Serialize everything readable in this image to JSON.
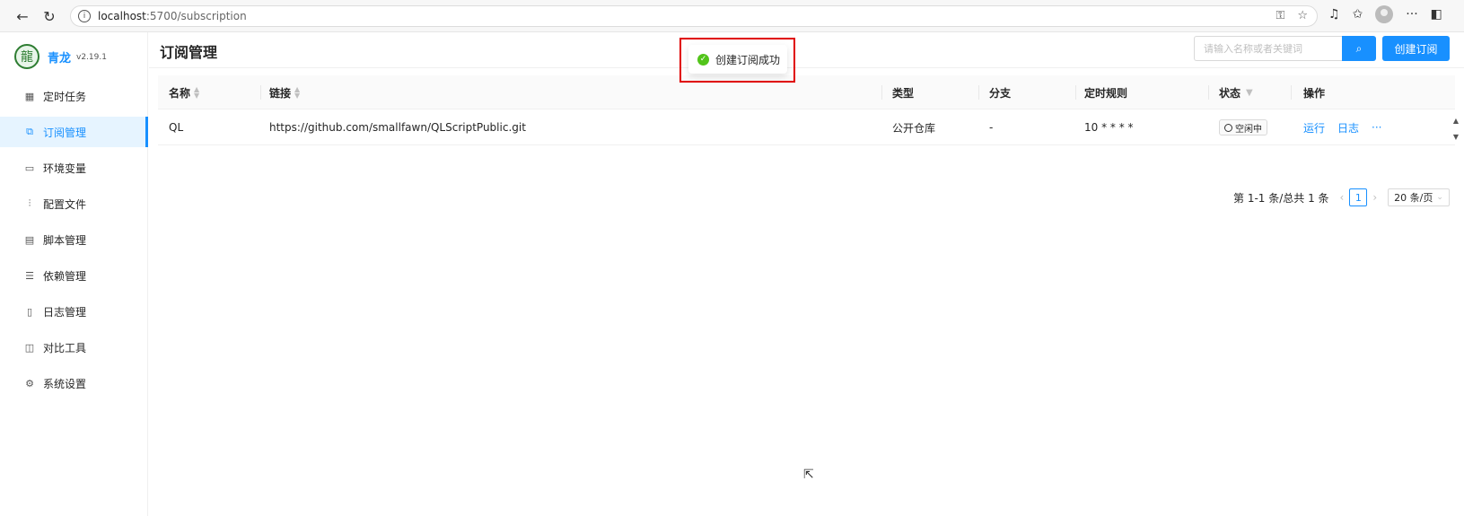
{
  "browser": {
    "url_host": "localhost",
    "url_rest": ":5700/subscription"
  },
  "sidebar": {
    "brand": "青龙",
    "version": "v2.19.1",
    "items": [
      {
        "label": "定时任务",
        "icon": "calendar-icon"
      },
      {
        "label": "订阅管理",
        "icon": "subscription-icon",
        "active": true
      },
      {
        "label": "环境变量",
        "icon": "monitor-icon"
      },
      {
        "label": "配置文件",
        "icon": "sliders-icon"
      },
      {
        "label": "脚本管理",
        "icon": "script-icon"
      },
      {
        "label": "依赖管理",
        "icon": "database-icon"
      },
      {
        "label": "日志管理",
        "icon": "log-icon"
      },
      {
        "label": "对比工具",
        "icon": "diff-icon"
      },
      {
        "label": "系统设置",
        "icon": "gear-icon"
      }
    ]
  },
  "header": {
    "title": "订阅管理",
    "search_placeholder": "请输入名称或者关键词",
    "create_label": "创建订阅"
  },
  "table": {
    "columns": [
      "名称",
      "链接",
      "类型",
      "分支",
      "定时规则",
      "状态",
      "操作"
    ],
    "rows": [
      {
        "name": "QL",
        "url": "https://github.com/smallfawn/QLScriptPublic.git",
        "type": "公开仓库",
        "branch": "-",
        "schedule": "10 * * * *",
        "status": "空闲中",
        "actions": [
          "运行",
          "日志"
        ],
        "more": "···"
      }
    ]
  },
  "pagination": {
    "summary": "第 1-1 条/总共 1 条",
    "current": "1",
    "page_size": "20 条/页"
  },
  "toast": {
    "message": "创建订阅成功"
  }
}
